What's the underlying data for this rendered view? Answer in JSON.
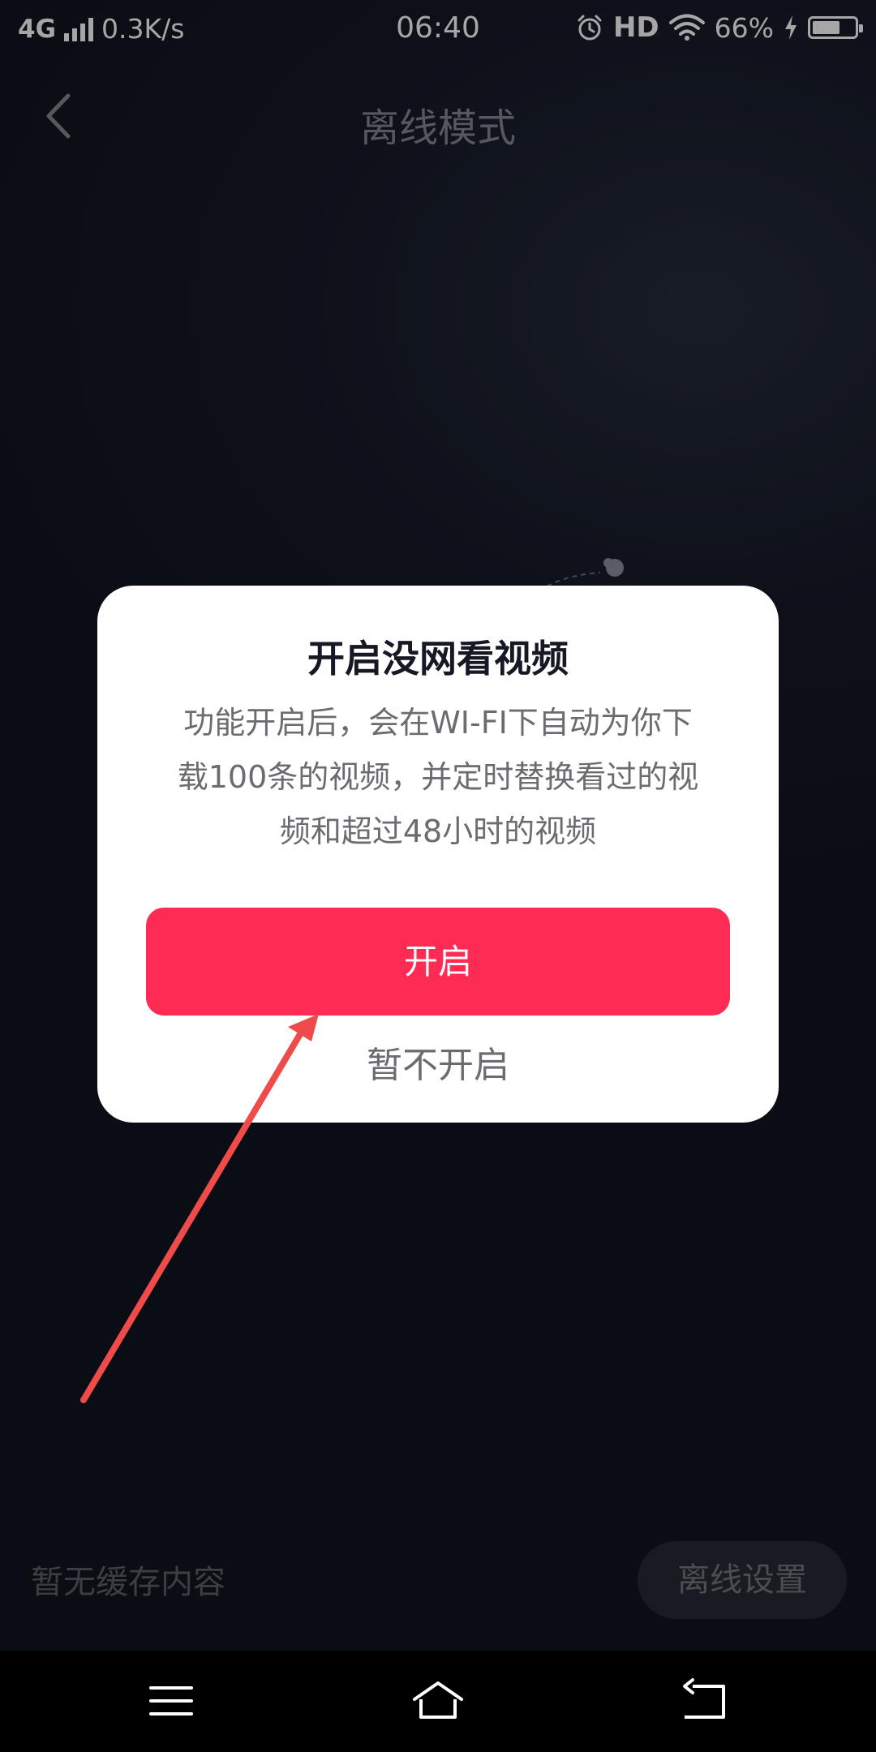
{
  "status_bar": {
    "network": "4G",
    "speed": "0.3K/s",
    "time": "06:40",
    "hd": "HD",
    "battery": "66%",
    "battery_level": 0.66,
    "icons": [
      "signal-icon",
      "alarm-icon",
      "wifi-icon",
      "charging-icon",
      "battery-icon"
    ]
  },
  "header": {
    "title": "离线模式",
    "back_icon": "back-chevron-icon"
  },
  "dialog": {
    "title": "开启没网看视频",
    "body_lines": [
      "功能开启后，会在WI-FI下自动为你下",
      "载100条的视频，并定时替换看过的视",
      "频和超过48小时的视频"
    ],
    "primary_label": "开启",
    "secondary_label": "暂不开启"
  },
  "footer": {
    "empty_text": "暂无缓存内容",
    "settings_label": "离线设置"
  },
  "nav_bar": {
    "icons": [
      "menu-icon",
      "home-icon",
      "back-icon"
    ]
  },
  "colors": {
    "accent": "#fe2c55",
    "background": "#151a27",
    "annotation_arrow": "#f04b4b"
  }
}
